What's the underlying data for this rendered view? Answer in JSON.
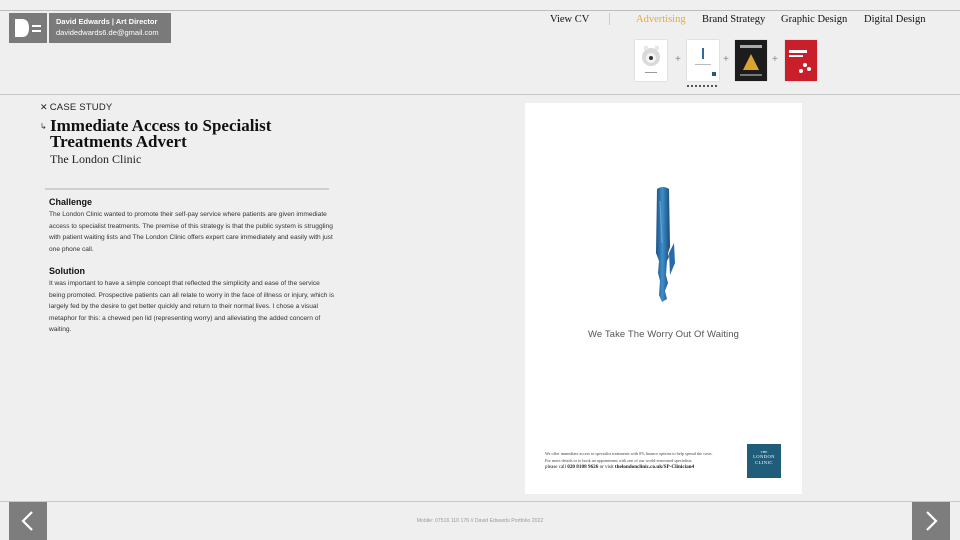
{
  "brand": {
    "name_title": "David Edwards | Art Director",
    "email": "davidedwards6.de@gmail.com",
    "logo_bg": "#7a7a7a"
  },
  "nav": {
    "view_cv": "View CV",
    "items": [
      "Advertising",
      "Brand Strategy",
      "Graphic Design",
      "Digital Design"
    ],
    "active": "Advertising",
    "active_color": "#e8a93a"
  },
  "thumbnails": [
    {
      "name": "thumb-wrench-ad",
      "icon": "wrench-icon"
    },
    {
      "name": "thumb-london-clinic-ad",
      "icon": "pen-lid-icon",
      "selected": true
    },
    {
      "name": "thumb-dark-poster",
      "icon": "poster-icon"
    },
    {
      "name": "thumb-red-poster",
      "icon": "poster-icon"
    }
  ],
  "case": {
    "label": "CASE STUDY",
    "title": "Immediate Access to Specialist Treatments Advert",
    "client": "The London Clinic",
    "challenge_heading": "Challenge",
    "challenge_text": "The London Clinic wanted to promote their self-pay service where patients are given immediate access to specialist treatments. The premise of this strategy is that the public system is struggling with patient waiting lists and The London Clinic offers expert care immediately and easily with just one phone call.",
    "solution_heading": "Solution",
    "solution_text": "It was important to have a simple concept that reflected the simplicity and ease of the service being promoted. Prospective patients can all relate to worry in the face of illness or injury, which is largely fed by the desire to get better quickly and return to their normal lives. I chose a visual metaphor for this: a chewed pen lid (representing worry) and alleviating the added concern of waiting."
  },
  "ad": {
    "tagline": "We Take The Worry Out Of Waiting",
    "fine_line1": "We offer immediate access to specialist treatments with 0% finance options to help spread the costs.",
    "fine_line2": "For more details or to book an appointment with one of our world-renowned specialists,",
    "cta_prefix": "please call",
    "phone": "020 8108 9626",
    "cta_mid": "or visit",
    "url": "thelondonclinic.co.uk/SP-Clinician4",
    "logo_the": "THE",
    "logo_line1": "LONDON",
    "logo_line2": "CLINIC",
    "logo_color": "#1f5d7a"
  },
  "footer": {
    "text": "Mobile: 07516 110 176 // David Edwards Portfolio 2022"
  }
}
